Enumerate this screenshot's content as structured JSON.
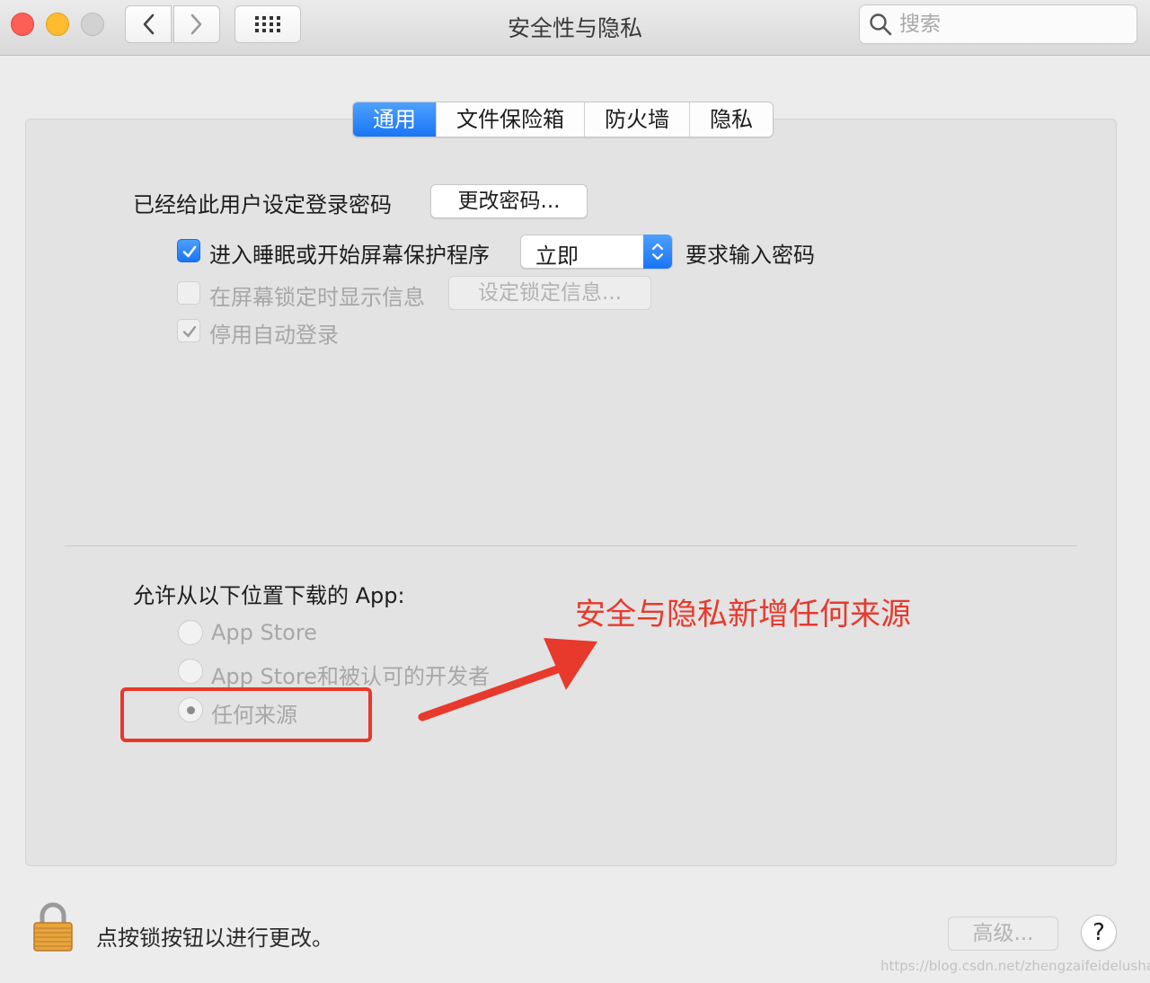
{
  "window": {
    "title": "安全性与隐私",
    "search_placeholder": "搜索"
  },
  "tabs": [
    {
      "label": "通用",
      "active": true
    },
    {
      "label": "文件保险箱",
      "active": false
    },
    {
      "label": "防火墙",
      "active": false
    },
    {
      "label": "隐私",
      "active": false
    }
  ],
  "general": {
    "password_label": "已经给此用户设定登录密码",
    "change_password_button": "更改密码...",
    "require_password": {
      "checked": true,
      "label": "进入睡眠或开始屏幕保护程序",
      "delay_value": "立即",
      "suffix": "要求输入密码"
    },
    "lock_message": {
      "checked": false,
      "label": "在屏幕锁定时显示信息",
      "button": "设定锁定信息..."
    },
    "disable_auto_login": {
      "checked": true,
      "label": "停用自动登录"
    }
  },
  "downloads": {
    "heading": "允许从以下位置下载的 App:",
    "options": [
      {
        "label": "App Store",
        "selected": false
      },
      {
        "label": "App Store和被认可的开发者",
        "selected": false
      },
      {
        "label": "任何来源",
        "selected": true
      }
    ]
  },
  "annotation": {
    "text": "安全与隐私新增任何来源",
    "color": "#e8392d"
  },
  "footer": {
    "lock_text": "点按锁按钮以进行更改。",
    "advanced_button": "高级...",
    "help_button": "?"
  },
  "watermark": "https://blog.csdn.net/zhengzaifeidelushang",
  "colors": {
    "accent": "#1a75f5",
    "close": "#fd5f57",
    "minimize": "#febc2e",
    "annotation": "#e8392d"
  }
}
